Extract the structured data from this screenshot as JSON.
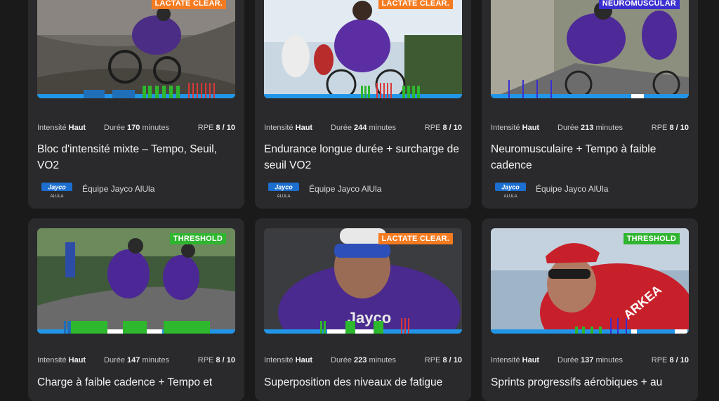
{
  "cards": [
    {
      "badge": "LACTATE CLEAR.",
      "badge_color": "#f47b20",
      "intensity_label": "Intensité",
      "intensity_value": "Haut",
      "duration_label": "Durée",
      "duration_value": "170",
      "duration_unit": "minutes",
      "rpe_label": "RPE",
      "rpe_value": "8 / 10",
      "title": "Bloc d'intensité mixte – Tempo, Seuil, VO2",
      "team": "Équipe Jayco AlUla",
      "team_logo_text": "Jayco",
      "team_logo_sub": "ALULA"
    },
    {
      "badge": "LACTATE CLEAR.",
      "badge_color": "#f47b20",
      "intensity_label": "Intensité",
      "intensity_value": "Haut",
      "duration_label": "Durée",
      "duration_value": "244",
      "duration_unit": "minutes",
      "rpe_label": "RPE",
      "rpe_value": "8 / 10",
      "title": "Endurance longue durée + surcharge de seuil VO2",
      "team": "Équipe Jayco AlUla",
      "team_logo_text": "Jayco",
      "team_logo_sub": "ALULA"
    },
    {
      "badge": "NEUROMUSCULAR",
      "badge_color": "#3a2fd0",
      "intensity_label": "Intensité",
      "intensity_value": "Haut",
      "duration_label": "Durée",
      "duration_value": "213",
      "duration_unit": "minutes",
      "rpe_label": "RPE",
      "rpe_value": "8 / 10",
      "title": "Neuromusculaire + Tempo à faible cadence",
      "team": "Équipe Jayco AlUla",
      "team_logo_text": "Jayco",
      "team_logo_sub": "ALULA"
    },
    {
      "badge": "THRESHOLD",
      "badge_color": "#2fb52f",
      "intensity_label": "Intensité",
      "intensity_value": "Haut",
      "duration_label": "Durée",
      "duration_value": "147",
      "duration_unit": "minutes",
      "rpe_label": "RPE",
      "rpe_value": "8 / 10",
      "title": "Charge à faible cadence + Tempo et"
    },
    {
      "badge": "LACTATE CLEAR.",
      "badge_color": "#f47b20",
      "intensity_label": "Intensité",
      "intensity_value": "Haut",
      "duration_label": "Durée",
      "duration_value": "223",
      "duration_unit": "minutes",
      "rpe_label": "RPE",
      "rpe_value": "8 / 10",
      "title": "Superposition des niveaux de fatigue"
    },
    {
      "badge": "THRESHOLD",
      "badge_color": "#2fb52f",
      "intensity_label": "Intensité",
      "intensity_value": "Haut",
      "duration_label": "Durée",
      "duration_value": "137",
      "duration_unit": "minutes",
      "rpe_label": "RPE",
      "rpe_value": "8 / 10",
      "title": "Sprints progressifs aérobiques + au"
    }
  ]
}
